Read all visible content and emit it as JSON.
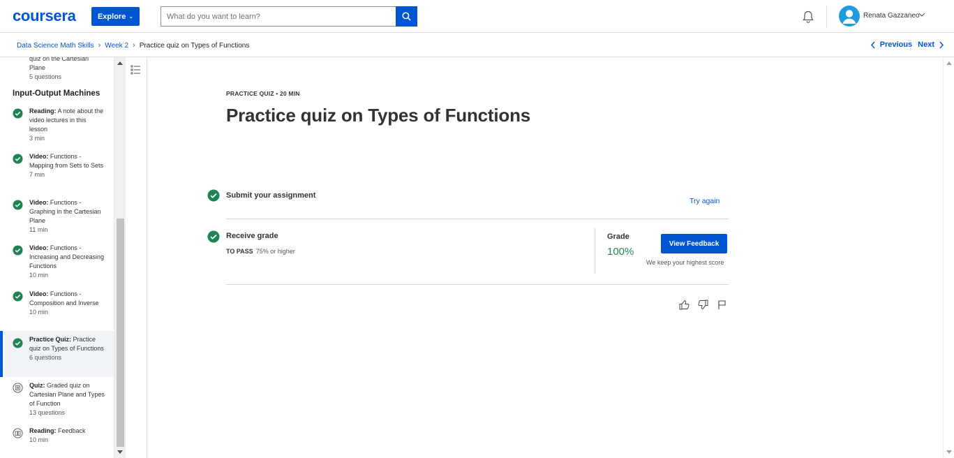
{
  "header": {
    "logo": "coursera",
    "explore_label": "Explore",
    "search_placeholder": "What do you want to learn?",
    "user_name": "Renata Gazzaneo",
    "icons": [
      "search-icon",
      "bell-icon",
      "user-avatar-icon",
      "chevron-down-icon"
    ]
  },
  "breadcrumb": {
    "items": [
      "Data Science Math Skills",
      "Week 2",
      "Practice quiz on Types of Functions"
    ],
    "previous": "Previous",
    "next": "Next"
  },
  "sidebar": {
    "partial_item": {
      "line1": "quiz on the Cartesian",
      "line2": "Plane",
      "meta": "5 questions"
    },
    "section_title": "Input-Output Machines",
    "items": [
      {
        "type": "Reading:",
        "title": "A note about the video lectures in this lesson",
        "meta": "3 min",
        "status": "completed"
      },
      {
        "type": "Video:",
        "title": "Functions - Mapping from Sets to Sets",
        "meta": "7 min",
        "status": "completed"
      },
      {
        "type": "Video:",
        "title": "Functions - Graphing in the Cartesian Plane",
        "meta": "11 min",
        "status": "completed"
      },
      {
        "type": "Video:",
        "title": "Functions - Increasing and Decreasing Functions",
        "meta": "10 min",
        "status": "completed"
      },
      {
        "type": "Video:",
        "title": "Functions - Composition and Inverse",
        "meta": "10 min",
        "status": "completed"
      },
      {
        "type": "Practice Quiz:",
        "title": "Practice quiz on Types of Functions",
        "meta": "6 questions",
        "status": "completed",
        "active": true
      },
      {
        "type": "Quiz:",
        "title": "Graded quiz on Cartesian Plane and Types of Function",
        "meta": "13 questions",
        "status": "quiz"
      },
      {
        "type": "Reading:",
        "title": "Feedback",
        "meta": "10 min",
        "status": "reading"
      }
    ]
  },
  "main": {
    "eyebrow": "PRACTICE QUIZ • 20 MIN",
    "title": "Practice quiz on Types of Functions",
    "submit_label": "Submit your assignment",
    "try_again": "Try again",
    "receive_label": "Receive grade",
    "to_pass_label": "TO PASS",
    "to_pass_value": "75% or higher",
    "grade_label": "Grade",
    "grade_value": "100%",
    "feedback_button": "View Feedback",
    "keep_note": "We keep your highest score"
  },
  "colors": {
    "brand": "#0056d2",
    "success": "#1f8354",
    "active_bg": "#f0f4f9"
  }
}
